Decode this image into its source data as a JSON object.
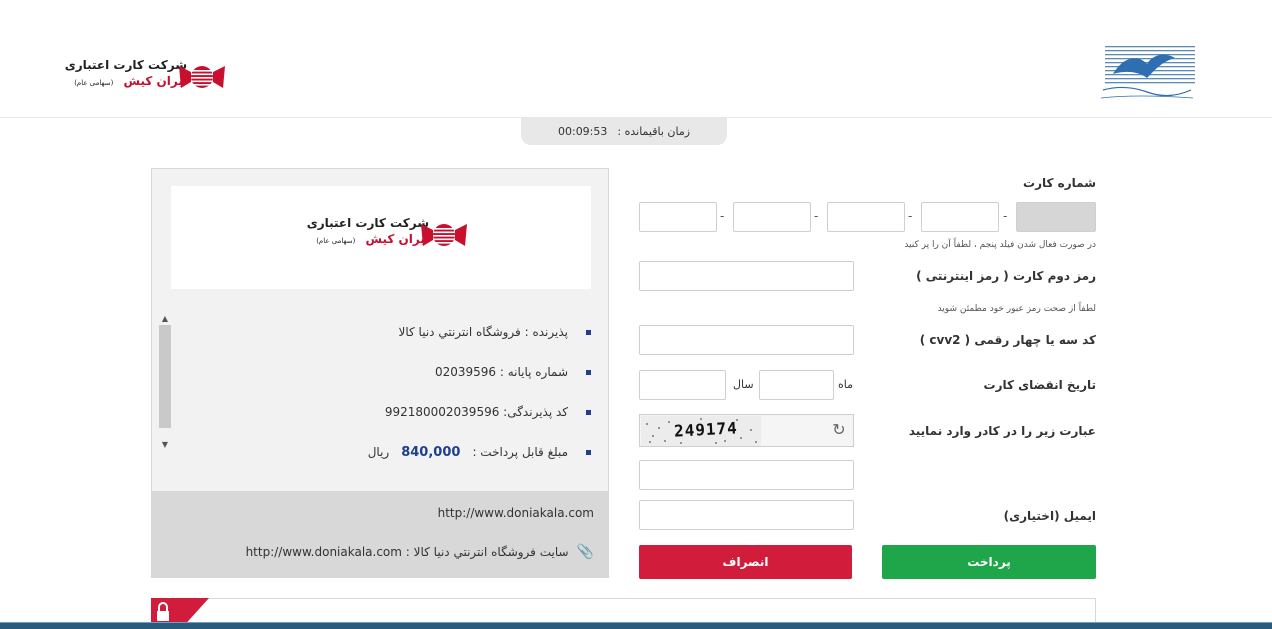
{
  "brand": {
    "title": "شرکت کارت اعتباری",
    "name": "ایران کیش",
    "tag": "(سهامی عام)"
  },
  "timer": {
    "label": "زمان باقیمانده :",
    "value": "00:09:53"
  },
  "merchant": {
    "items": [
      {
        "label": "پذیرنده : فروشگاه انترنتي دنيا کالا",
        "icon": "bullet"
      },
      {
        "label": "شماره پایانه : 02039596",
        "icon": "bullet"
      },
      {
        "label": "کد پذیرندگی: 992180002039596",
        "icon": "bullet"
      },
      {
        "label": "مبلغ قابل پرداخت :",
        "amount": "840,000",
        "unit": "ریال",
        "icon": "bullet"
      }
    ],
    "site_url": "http://www.doniakala.com",
    "site_line": "سایت فروشگاه انترنتي دنيا کالا : http://www.doniakala.com"
  },
  "form": {
    "card_number_label": "شماره کارت",
    "card_number_hint": "در صورت فعال شدن فیلد پنجم ، لطفاً آن را پر کنید",
    "pin2_label": "رمز دوم کارت ( رمز اینترنتی )",
    "pin2_hint": "لطفاً از صحت رمز عبور خود مطمئن شوید",
    "cvv2_label": "کد سه یا چهار رقمی ( cvv2 )",
    "expiry_label": "تاریخ انقضای کارت",
    "month_label": "ماه",
    "year_label": "سال",
    "captcha_label": "عبارت زیر را در کادر وارد نمایید",
    "captcha_text": "249174",
    "email_label": "ایمیل (اختیاری)",
    "pay_button": "پرداخت",
    "cancel_button": "انصراف"
  },
  "colors": {
    "brand_red": "#c8102e",
    "pay_green": "#1fa64a",
    "cancel_red": "#d21c3c",
    "accent_blue": "#1d3f8f"
  }
}
